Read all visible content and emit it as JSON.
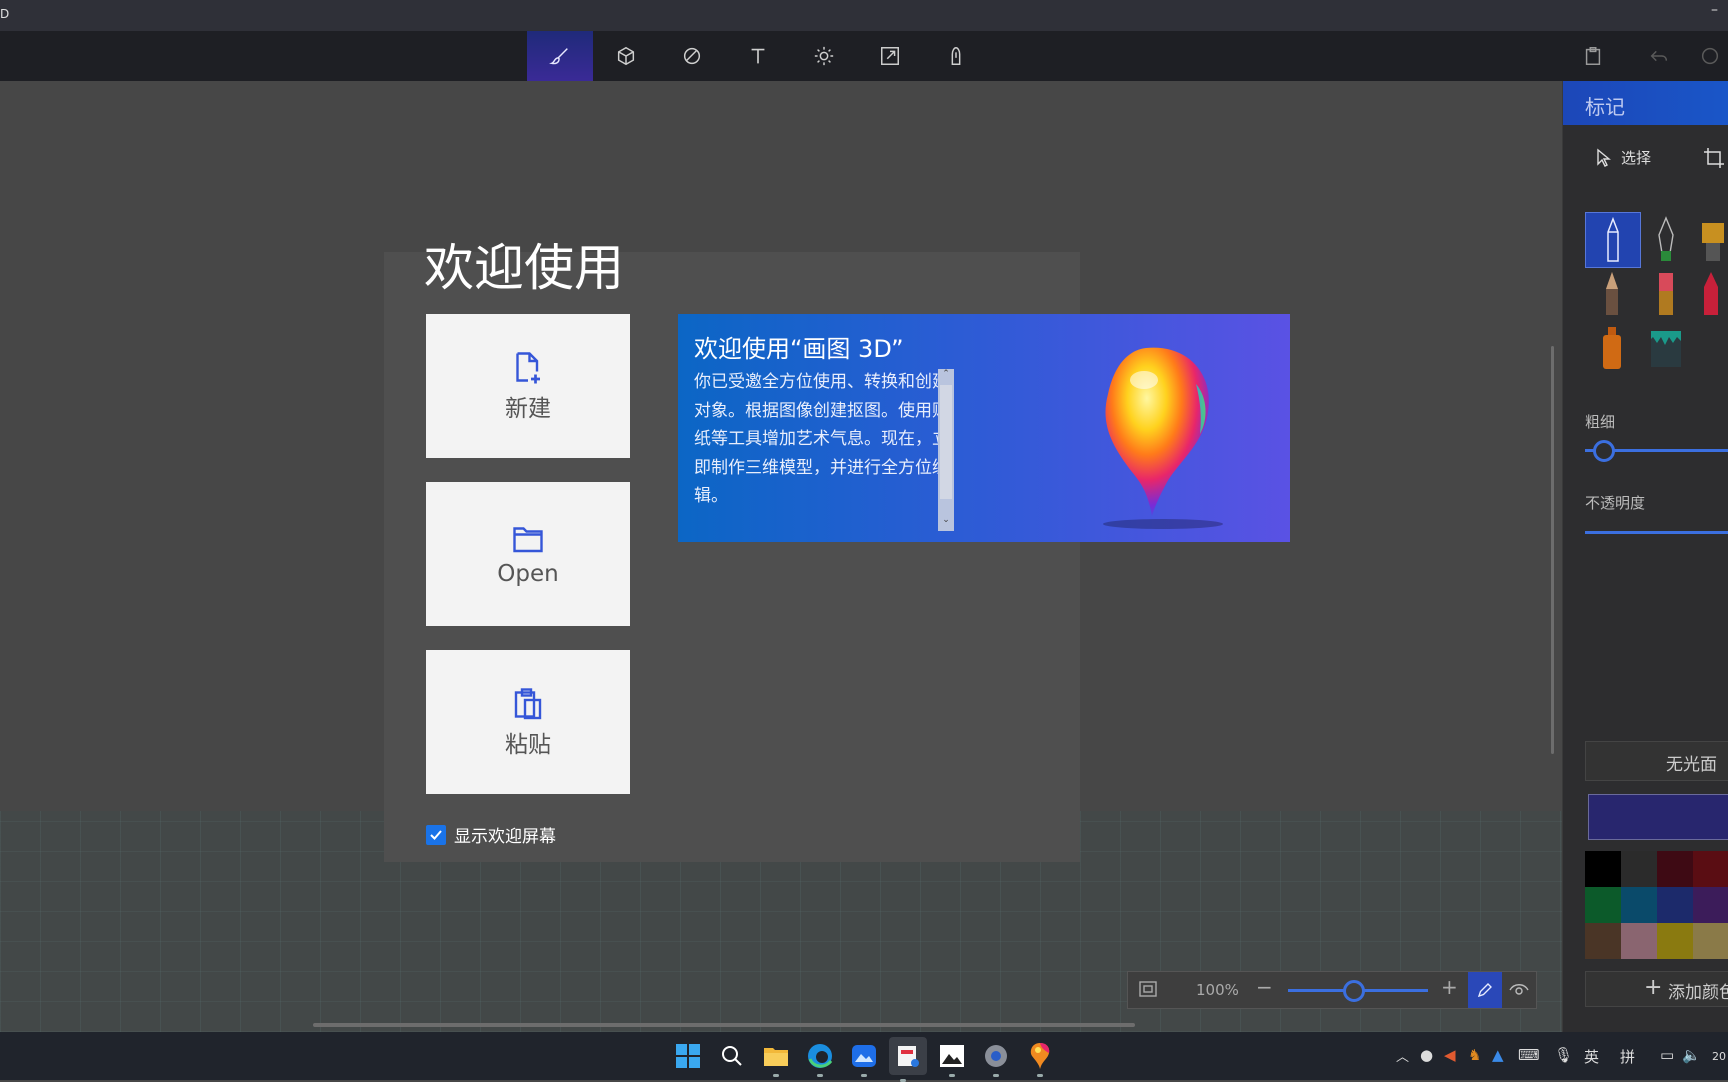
{
  "app": {
    "title": "D",
    "minimize_glyph": "–"
  },
  "toolbar": {
    "tools": [
      {
        "name": "brushes",
        "icon": "brush-icon",
        "active": true
      },
      {
        "name": "3d-shapes",
        "icon": "cube-icon"
      },
      {
        "name": "2d-shapes",
        "icon": "shapes-icon"
      },
      {
        "name": "text",
        "icon": "text-icon"
      },
      {
        "name": "effects",
        "icon": "sun-icon"
      },
      {
        "name": "canvas",
        "icon": "resize-icon"
      },
      {
        "name": "3d-library",
        "icon": "library-icon"
      }
    ],
    "right": [
      "paste-icon",
      "undo-icon",
      "history-icon"
    ]
  },
  "welcome": {
    "title": "欢迎使用",
    "tiles": {
      "new": "新建",
      "open": "Open",
      "paste": "粘贴"
    },
    "promo": {
      "title": "欢迎使用“画图 3D”",
      "body": "你已受邀全方位使用、转换和创建对象。根据图像创建抠图。使用贴纸等工具增加艺术气息。现在，立即制作三维模型，并进行全方位编辑。"
    },
    "show_welcome": {
      "label": "显示欢迎屏幕",
      "checked": true
    }
  },
  "zoom": {
    "value": "100%",
    "level": 0.45
  },
  "panel": {
    "title": "标记",
    "select_label": "选择",
    "size_label": "粗细",
    "opacity_label": "不透明度",
    "finish_label": "无光面",
    "add_color_label": "添加颜色",
    "current_color": "#28266e",
    "palette": [
      "#000000",
      "#2b2b2b",
      "#3e0a14",
      "#5a0d13",
      "#0c5a2a",
      "#0a4a6a",
      "#1c2a6b",
      "#3c1c5a",
      "#4a3526",
      "#8a6570",
      "#8a7a10",
      "#8a7a48"
    ]
  },
  "taskbar": {
    "apps": [
      "start-icon",
      "search-icon",
      "file-explorer-icon",
      "edge-icon",
      "photos-icon",
      "snipping-tool-icon",
      "photos-viewer-icon",
      "settings-icon",
      "paint-3d-icon"
    ],
    "tray": {
      "ime_lang": "英",
      "ime_mode": "拼",
      "clock_fragment": "20"
    }
  }
}
